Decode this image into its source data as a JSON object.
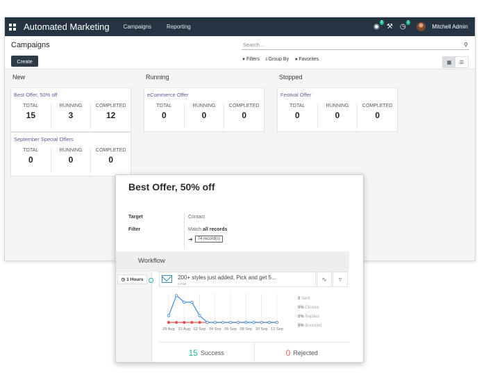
{
  "navbar": {
    "brand": "Automated Marketing",
    "menu": [
      "Campaigns",
      "Reporting"
    ],
    "chat_badge": "5",
    "activity_badge": "1",
    "user_name": "Mitchell Admin"
  },
  "control_panel": {
    "title": "Campaigns",
    "create_label": "Create",
    "search_placeholder": "Search...",
    "filters_label": "Filters",
    "groupby_label": "Group By",
    "favorites_label": "Favorites"
  },
  "columns": [
    {
      "title": "New",
      "cards": [
        {
          "name": "Best Offer, 50% off",
          "total": "15",
          "running": "3",
          "completed": "12"
        },
        {
          "name": "September Special Offers",
          "total": "0",
          "running": "0",
          "completed": "0"
        }
      ]
    },
    {
      "title": "Running",
      "cards": [
        {
          "name": "eCommerce Offer",
          "total": "0",
          "running": "0",
          "completed": "0"
        }
      ]
    },
    {
      "title": "Stopped",
      "cards": [
        {
          "name": "Festival Offer",
          "total": "0",
          "running": "0",
          "completed": "0"
        }
      ]
    }
  ],
  "stat_labels": {
    "total": "TOTAL",
    "running": "RUNNING",
    "completed": "COMPLETED"
  },
  "popup": {
    "title": "Best Offer, 50% off",
    "target_label": "Target",
    "target_value": "Contact",
    "filter_label": "Filter",
    "filter_prefix": "Match ",
    "filter_bold": "all records",
    "records": "74 record(s)",
    "workflow_title": "Workflow",
    "timer": "1 Hours",
    "activity_title": "200+ styles just added, Pick and get 5...",
    "activity_type": "e-mail",
    "success_count": "15",
    "success_label": "Success",
    "rejected_count": "0",
    "rejected_label": "Rejected",
    "legend": [
      {
        "value": "0",
        "label": "Sent"
      },
      {
        "value": "0%",
        "label": "Clicked"
      },
      {
        "value": "0%",
        "label": "Replied"
      },
      {
        "value": "0%",
        "label": "Bounced"
      }
    ]
  },
  "chart_data": {
    "type": "line",
    "x": [
      "29 Aug",
      "30 Aug",
      "31 Aug",
      "01 Sep",
      "02 Sep",
      "03 Sep",
      "04 Sep",
      "05 Sep",
      "06 Sep",
      "07 Sep",
      "08 Sep",
      "09 Sep",
      "10 Sep",
      "11 Sep",
      "12 Sep"
    ],
    "tick_labels": [
      "29 Aug",
      "31 Aug",
      "02 Sep",
      "04 Sep",
      "06 Sep",
      "08 Sep",
      "10 Sep",
      "12 Sep"
    ],
    "series": [
      {
        "values": [
          3,
          12,
          9,
          9,
          3,
          0,
          0,
          0,
          0,
          0,
          0,
          0,
          0,
          0,
          0
        ],
        "color": "#4a90d9"
      },
      {
        "values": [
          0,
          0,
          0,
          0,
          0,
          0,
          0,
          0,
          0,
          0,
          0,
          0,
          0,
          0,
          0
        ],
        "color": "#e05656"
      }
    ],
    "ylim": [
      0,
      13
    ],
    "grid": true
  }
}
